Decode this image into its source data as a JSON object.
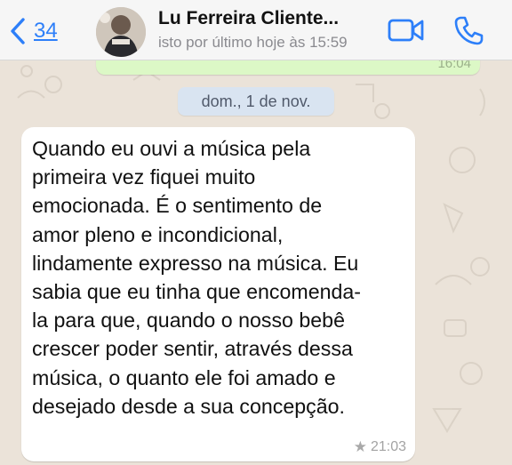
{
  "header": {
    "back_count": "34",
    "contact_name": "Lu Ferreira Cliente...",
    "last_seen": "isto por último hoje às 15:59"
  },
  "previous_message": {
    "time": "16:04"
  },
  "date_separator": "dom., 1 de nov.",
  "message": {
    "text": "Quando eu ouvi a música pela primeira vez fiquei muito emocionada. É o sentimento de amor pleno e incondicional, lindamente expresso na música. Eu sabia que eu tinha que encomenda-la para que, quando o nosso bebê crescer poder sentir, através dessa música, o quanto ele foi amado e desejado desde a sua concepção.",
    "lines": [
      "Quando eu ouvi a música pela",
      "primeira vez fiquei muito",
      "emocionada. É o sentimento de",
      "amor pleno e incondicional,",
      "lindamente expresso na música. Eu",
      "sabia que eu tinha que encomenda-",
      "la para que, quando o nosso bebê",
      "crescer poder sentir, através dessa",
      "música, o quanto ele foi amado e",
      "desejado desde a sua concepção."
    ],
    "starred": true,
    "time": "21:03"
  },
  "icons": {
    "back": "chevron-left-icon",
    "video": "video-camera-icon",
    "call": "phone-icon",
    "star": "star-icon"
  },
  "colors": {
    "accent": "#2d7ff9",
    "outgoing_bubble": "#dcf8c6",
    "incoming_bubble": "#ffffff",
    "date_pill": "#d9e4f1"
  }
}
